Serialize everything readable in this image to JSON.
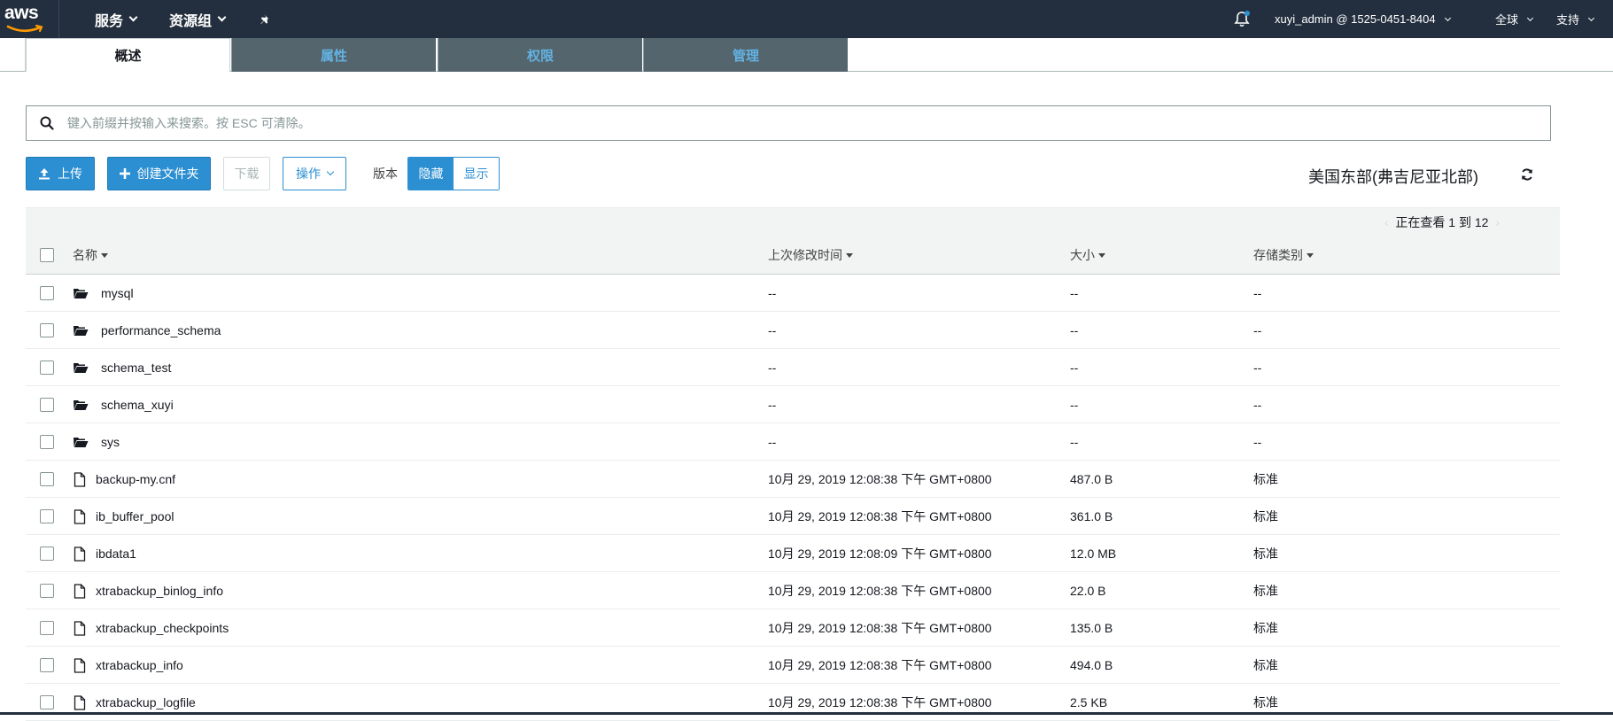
{
  "nav": {
    "logo_text": "aws",
    "services": "服务",
    "resource_groups": "资源组",
    "account": "xuyi_admin @ 1525-0451-8404",
    "region": "全球",
    "support": "支持"
  },
  "tabs": [
    {
      "label": "概述"
    },
    {
      "label": "属性"
    },
    {
      "label": "权限"
    },
    {
      "label": "管理"
    }
  ],
  "search": {
    "placeholder": "键入前缀并按输入来搜索。按 ESC 可清除。",
    "value": ""
  },
  "toolbar": {
    "upload": "上传",
    "create_folder": "创建文件夹",
    "download": "下载",
    "actions": "操作",
    "versions_label": "版本",
    "hide": "隐藏",
    "show": "显示",
    "region_name": "美国东部(弗吉尼亚北部)"
  },
  "paging": {
    "text": "正在查看 1 到 12"
  },
  "table": {
    "headers": {
      "name": "名称",
      "modified": "上次修改时间",
      "size": "大小",
      "storage": "存储类别"
    },
    "rows": [
      {
        "type": "folder",
        "name": "mysql",
        "modified": "--",
        "size": "--",
        "storage": "--"
      },
      {
        "type": "folder",
        "name": "performance_schema",
        "modified": "--",
        "size": "--",
        "storage": "--"
      },
      {
        "type": "folder",
        "name": "schema_test",
        "modified": "--",
        "size": "--",
        "storage": "--"
      },
      {
        "type": "folder",
        "name": "schema_xuyi",
        "modified": "--",
        "size": "--",
        "storage": "--"
      },
      {
        "type": "folder",
        "name": "sys",
        "modified": "--",
        "size": "--",
        "storage": "--"
      },
      {
        "type": "file",
        "name": "backup-my.cnf",
        "modified": "10月 29, 2019 12:08:38 下午 GMT+0800",
        "size": "487.0 B",
        "storage": "标准"
      },
      {
        "type": "file",
        "name": "ib_buffer_pool",
        "modified": "10月 29, 2019 12:08:38 下午 GMT+0800",
        "size": "361.0 B",
        "storage": "标准"
      },
      {
        "type": "file",
        "name": "ibdata1",
        "modified": "10月 29, 2019 12:08:09 下午 GMT+0800",
        "size": "12.0 MB",
        "storage": "标准"
      },
      {
        "type": "file",
        "name": "xtrabackup_binlog_info",
        "modified": "10月 29, 2019 12:08:38 下午 GMT+0800",
        "size": "22.0 B",
        "storage": "标准"
      },
      {
        "type": "file",
        "name": "xtrabackup_checkpoints",
        "modified": "10月 29, 2019 12:08:38 下午 GMT+0800",
        "size": "135.0 B",
        "storage": "标准"
      },
      {
        "type": "file",
        "name": "xtrabackup_info",
        "modified": "10月 29, 2019 12:08:38 下午 GMT+0800",
        "size": "494.0 B",
        "storage": "标准"
      },
      {
        "type": "file",
        "name": "xtrabackup_logfile",
        "modified": "10月 29, 2019 12:08:38 下午 GMT+0800",
        "size": "2.5 KB",
        "storage": "标准"
      }
    ]
  }
}
